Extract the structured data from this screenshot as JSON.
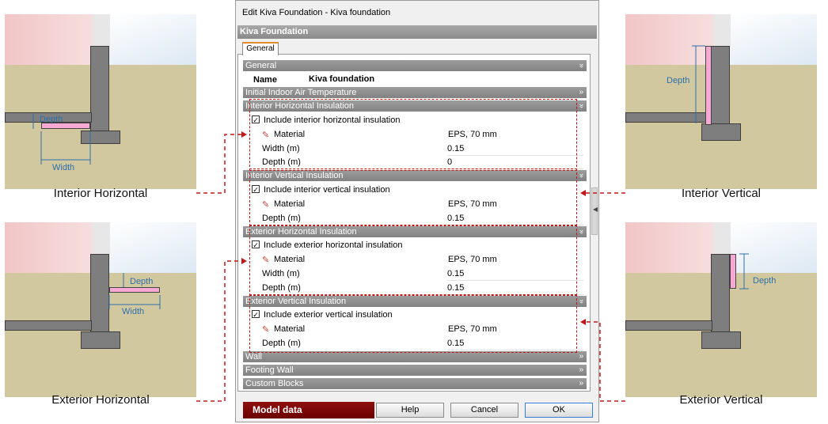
{
  "dialog": {
    "title": "Edit Kiva Foundation - Kiva foundation",
    "header": "Kiva Foundation",
    "tab": "General"
  },
  "sections": {
    "general": "General",
    "indoor_air": "Initial Indoor Air Temperature",
    "int_horiz": "Interior Horizontal Insulation",
    "int_vert": "Interior Vertical Insulation",
    "ext_horiz": "Exterior Horizontal Insulation",
    "ext_vert": "Exterior Vertical Insulation",
    "wall": "Wall",
    "footing_wall": "Footing Wall",
    "custom_blocks": "Custom Blocks"
  },
  "chevrons": {
    "expanded": "»",
    "collapsed": "»"
  },
  "fields": {
    "name_label": "Name",
    "name_value": "Kiva foundation",
    "int_horiz_include": "Include interior horizontal insulation",
    "int_horiz_material_label": "Material",
    "int_horiz_material": "EPS, 70 mm",
    "int_horiz_width_label": "Width (m)",
    "int_horiz_width": "0.15",
    "int_horiz_depth_label": "Depth (m)",
    "int_horiz_depth": "0",
    "int_vert_include": "Include interior vertical insulation",
    "int_vert_material_label": "Material",
    "int_vert_material": "EPS, 70 mm",
    "int_vert_depth_label": "Depth (m)",
    "int_vert_depth": "0.15",
    "ext_horiz_include": "Include exterior horizontal insulation",
    "ext_horiz_material_label": "Material",
    "ext_horiz_material": "EPS, 70 mm",
    "ext_horiz_width_label": "Width (m)",
    "ext_horiz_width": "0.15",
    "ext_horiz_depth_label": "Depth (m)",
    "ext_horiz_depth": "0.15",
    "ext_vert_include": "Include exterior vertical insulation",
    "ext_vert_material_label": "Material",
    "ext_vert_material": "EPS, 70 mm",
    "ext_vert_depth_label": "Depth (m)",
    "ext_vert_depth": "0.15",
    "check_mark": "✓"
  },
  "buttons": {
    "model_data": "Model data",
    "help": "Help",
    "cancel": "Cancel",
    "ok": "OK"
  },
  "panels": {
    "interior_horizontal": {
      "caption": "Interior Horizontal",
      "depth": "Depth",
      "width": "Width"
    },
    "interior_vertical": {
      "caption": "Interior Vertical",
      "depth": "Depth"
    },
    "exterior_horizontal": {
      "caption": "Exterior Horizontal",
      "depth": "Depth",
      "width": "Width"
    },
    "exterior_vertical": {
      "caption": "Exterior Vertical",
      "depth": "Depth"
    }
  },
  "colors": {
    "accent_red": "#c01818",
    "insulation_pink": "#f6a9d2",
    "ground": "#d1c8a0",
    "dimension_blue": "#2f6fa8"
  }
}
